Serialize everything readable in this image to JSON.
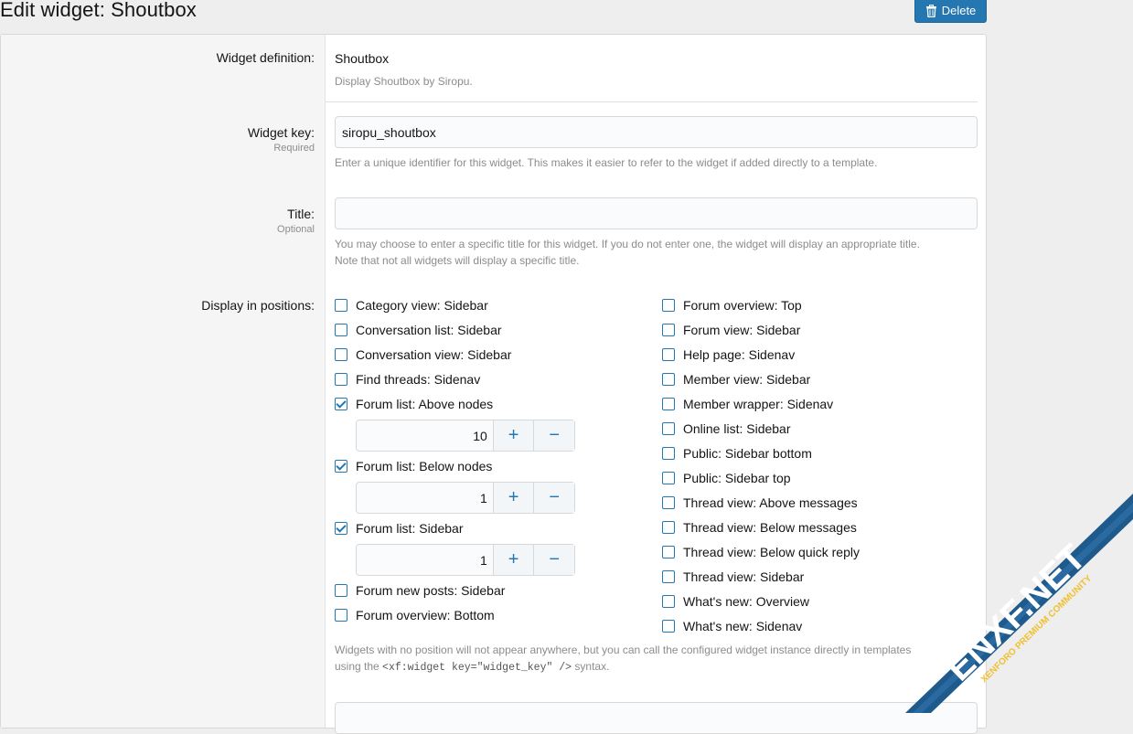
{
  "page": {
    "title": "Edit widget: Shoutbox",
    "delete_label": "Delete"
  },
  "form": {
    "definition": {
      "label": "Widget definition:",
      "value": "Shoutbox",
      "description": "Display Shoutbox by Siropu."
    },
    "key": {
      "label": "Widget key:",
      "hint": "Required",
      "value": "siropu_shoutbox",
      "explain": "Enter a unique identifier for this widget. This makes it easier to refer to the widget if added directly to a template."
    },
    "title": {
      "label": "Title:",
      "hint": "Optional",
      "value": "",
      "explain_line1": "You may choose to enter a specific title for this widget. If you do not enter one, the widget will display an appropriate title.",
      "explain_line2": "Note that not all widgets will display a specific title."
    },
    "positions": {
      "label": "Display in positions:",
      "left": [
        {
          "label": "Category view: Sidebar",
          "checked": false
        },
        {
          "label": "Conversation list: Sidebar",
          "checked": false
        },
        {
          "label": "Conversation view: Sidebar",
          "checked": false
        },
        {
          "label": "Find threads: Sidenav",
          "checked": false
        },
        {
          "label": "Forum list: Above nodes",
          "checked": true,
          "order": "10"
        },
        {
          "label": "Forum list: Below nodes",
          "checked": true,
          "order": "1"
        },
        {
          "label": "Forum list: Sidebar",
          "checked": true,
          "order": "1"
        },
        {
          "label": "Forum new posts: Sidebar",
          "checked": false
        },
        {
          "label": "Forum overview: Bottom",
          "checked": false
        }
      ],
      "right": [
        {
          "label": "Forum overview: Top",
          "checked": false
        },
        {
          "label": "Forum view: Sidebar",
          "checked": false
        },
        {
          "label": "Help page: Sidenav",
          "checked": false
        },
        {
          "label": "Member view: Sidebar",
          "checked": false
        },
        {
          "label": "Member wrapper: Sidenav",
          "checked": false
        },
        {
          "label": "Online list: Sidebar",
          "checked": false
        },
        {
          "label": "Public: Sidebar bottom",
          "checked": false
        },
        {
          "label": "Public: Sidebar top",
          "checked": false
        },
        {
          "label": "Thread view: Above messages",
          "checked": false
        },
        {
          "label": "Thread view: Below messages",
          "checked": false
        },
        {
          "label": "Thread view: Below quick reply",
          "checked": false
        },
        {
          "label": "Thread view: Sidebar",
          "checked": false
        },
        {
          "label": "What's new: Overview",
          "checked": false
        },
        {
          "label": "What's new: Sidenav",
          "checked": false
        }
      ],
      "spin_plus": "+",
      "spin_minus": "−",
      "explain_line1": "Widgets with no position will not appear anywhere, but you can call the configured widget instance directly in templates",
      "explain_prefix": "using the ",
      "explain_code": "<xf:widget key=\"widget_key\" />",
      "explain_suffix": " syntax."
    }
  },
  "watermark": {
    "brand": "ENXF.NET",
    "tagline": "XENFORO PREMIUM COMMUNITY",
    "color": "#1f5a8c"
  },
  "colors": {
    "accent": "#2577b1",
    "muted_text": "#8c8c8c"
  }
}
